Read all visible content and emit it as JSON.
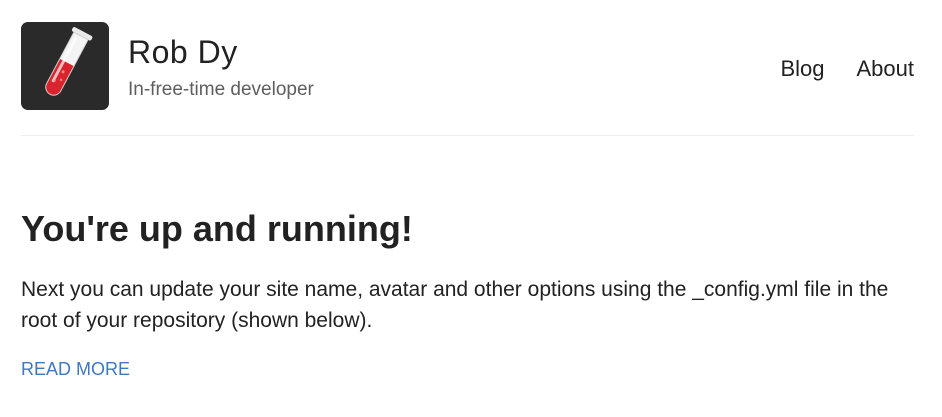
{
  "header": {
    "site_name": "Rob Dy",
    "site_description": "In-free-time developer",
    "avatar_icon": "test-tube-icon"
  },
  "nav": {
    "items": [
      {
        "label": "Blog"
      },
      {
        "label": "About"
      }
    ]
  },
  "post": {
    "title": "You're up and running!",
    "excerpt": "Next you can update your site name, avatar and other options using the _config.yml file in the root of your repository (shown below).",
    "read_more_label": "READ MORE"
  },
  "colors": {
    "link": "#4078c0",
    "text": "#222222",
    "muted": "#5e5e5e",
    "avatar_bg": "#2a2a2a",
    "liquid": "#d9232d"
  }
}
